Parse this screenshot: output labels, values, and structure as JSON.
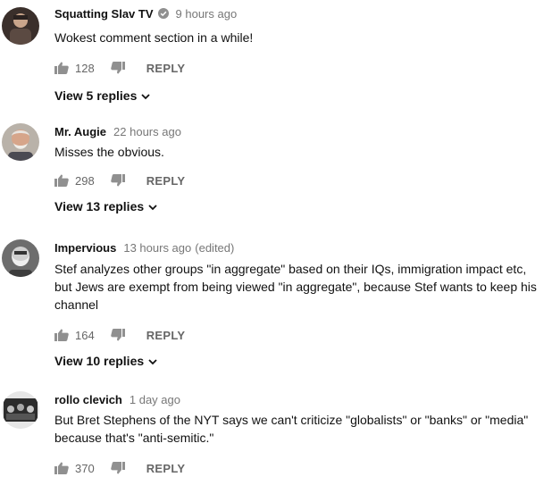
{
  "comments": [
    {
      "author": "Squatting Slav TV",
      "verified": true,
      "time": "9 hours ago",
      "edited": "",
      "text": "Wokest comment section in a while!",
      "likes": "128",
      "reply_label": "REPLY",
      "view_replies": "View 5 replies"
    },
    {
      "author": "Mr. Augie",
      "verified": false,
      "time": "22 hours ago",
      "edited": "",
      "text": "Misses the obvious.",
      "likes": "298",
      "reply_label": "REPLY",
      "view_replies": "View 13 replies"
    },
    {
      "author": "Impervious",
      "verified": false,
      "time": "13 hours ago",
      "edited": "(edited)",
      "text": "Stef analyzes other groups \"in aggregate\" based on their IQs, immigration impact etc, but Jews are exempt from being viewed \"in aggregate\", because Stef wants to keep his channel",
      "likes": "164",
      "reply_label": "REPLY",
      "view_replies": "View 10 replies"
    },
    {
      "author": "rollo clevich",
      "verified": false,
      "time": "1 day ago",
      "edited": "",
      "text": "But Bret Stephens of the NYT says we can't criticize \"globalists\" or \"banks\" or \"media\" because that's \"anti-semitic.\"",
      "likes": "370",
      "reply_label": "REPLY",
      "view_replies": ""
    }
  ],
  "icons": {
    "like": "thumbs-up-icon",
    "dislike": "thumbs-down-icon",
    "verified": "check-circle-icon",
    "expand": "chevron-down-icon"
  },
  "colors": {
    "author": "#111111",
    "meta": "#777777",
    "action": "#666666",
    "icon": "#909090"
  }
}
